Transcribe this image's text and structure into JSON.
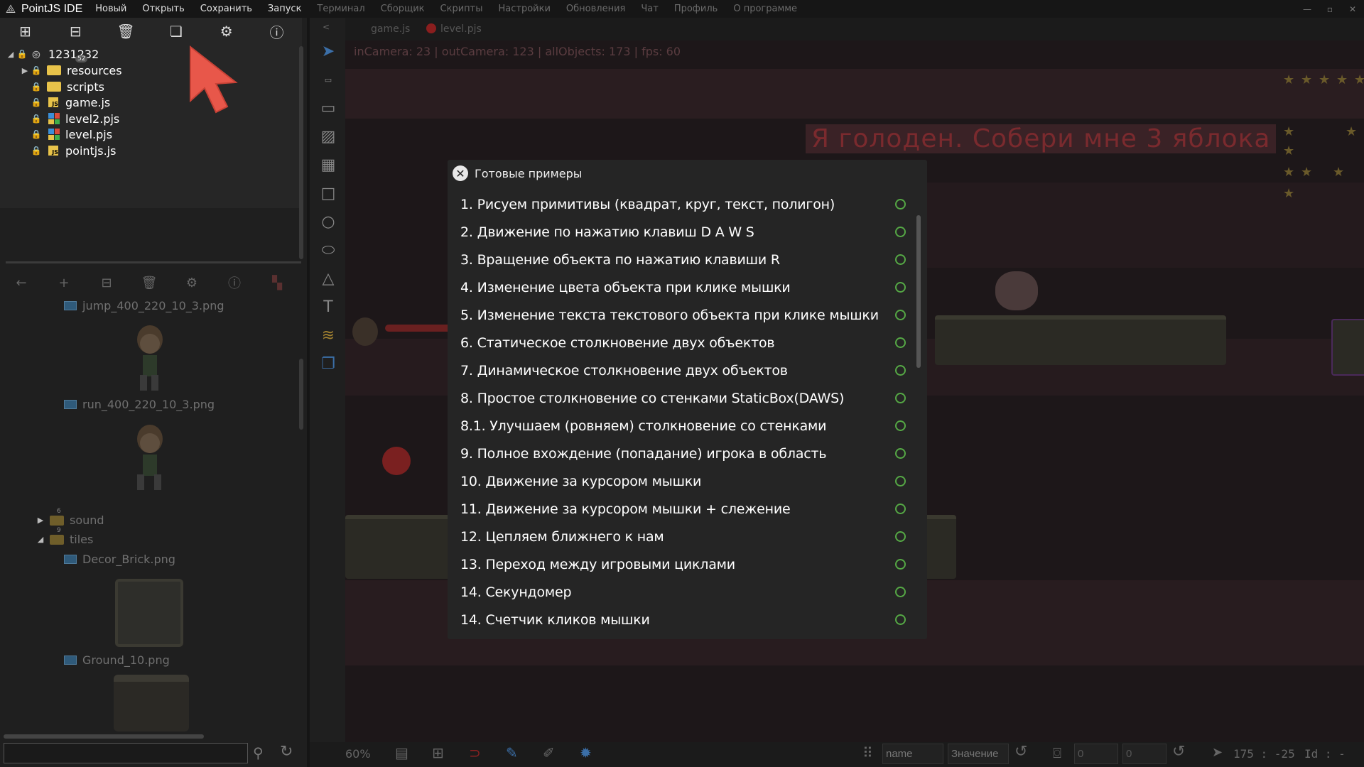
{
  "app": {
    "title": "PointJS IDE",
    "menu": [
      "Новый",
      "Открыть",
      "Сохранить",
      "Запуск"
    ],
    "menu_dim": [
      "Терминал",
      "Сборщик",
      "Скрипты",
      "Настройки",
      "Обновления",
      "Чат",
      "Профиль",
      "О программе"
    ],
    "window_controls": [
      "—",
      "▫",
      "✕"
    ]
  },
  "project_tree": {
    "root": "1231232",
    "items": [
      {
        "name": "resources",
        "type": "folder",
        "badge": "52"
      },
      {
        "name": "scripts",
        "type": "folder"
      },
      {
        "name": "game.js",
        "type": "js"
      },
      {
        "name": "level2.pjs",
        "type": "pjs"
      },
      {
        "name": "level.pjs",
        "type": "pjs"
      },
      {
        "name": "pointjs.js",
        "type": "js"
      }
    ]
  },
  "resources": {
    "files": [
      "jump_400_220_10_3.png",
      "run_400_220_10_3.png",
      "Decor_Brick.png",
      "Ground_10.png"
    ],
    "folders": [
      {
        "name": "sound",
        "badge": "6"
      },
      {
        "name": "tiles",
        "badge": "9"
      }
    ]
  },
  "tabs": [
    {
      "label": "game.js"
    },
    {
      "label": "level.pjs"
    }
  ],
  "canvas": {
    "camera_info": "inCamera: 23 | outCamera: 123 | allObjects: 173 | fps: 60",
    "game_text": "Я голоден. Собери мне 3 яблока"
  },
  "modal": {
    "title": "Готовые примеры",
    "examples": [
      "1. Рисуем примитивы (квадрат, круг, текст, полигон)",
      "2. Движение по нажатию клавиш D A W S",
      "3. Вращение объекта по нажатию клавиши R",
      "4. Изменение цвета объекта при клике мышки",
      "5. Изменение текста текстового объекта при клике мышки",
      "6. Статическое столкновение двух объектов",
      "7. Динамическое столкновение двух объектов",
      "8. Простое столкновение со стенками StaticBox(DAWS)",
      "8.1. Улучшаем (ровняем) столкновение со стенками",
      "9. Полное вхождение (попадание) игрока в область",
      "10. Движение за курсором мышки",
      "11. Движение за курсором мышки + слежение",
      "12. Цепляем ближнего к нам",
      "13. Переход между игровыми циклами",
      "14. Секундомер",
      "14. Счетчик кликов мышки"
    ]
  },
  "statusbar": {
    "zoom": "60%",
    "name_field": "name",
    "value_placeholder": "Значение",
    "x_field": "0",
    "y_field": "0",
    "coords": "175 : -25",
    "id_label": "Id : -"
  },
  "colors": {
    "accent_green": "#55a845",
    "cursor_red": "#e8574a"
  }
}
